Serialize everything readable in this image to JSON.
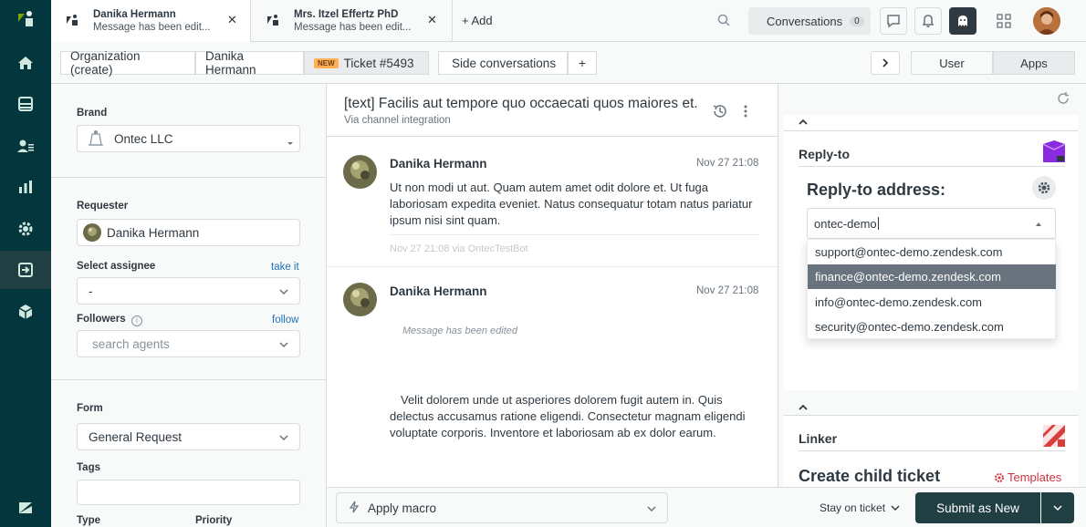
{
  "tabs": [
    {
      "title": "Danika Hermann",
      "subtitle": "Message has been edit..."
    },
    {
      "title": "Mrs. Itzel Effertz PhD",
      "subtitle": "Message has been edit..."
    }
  ],
  "add_tab_label": "+ Add",
  "conversations": {
    "label": "Conversations",
    "count": "0"
  },
  "breadcrumbs": {
    "organization": "Organization (create)",
    "requester": "Danika Hermann",
    "new_badge": "NEW",
    "ticket": "Ticket #5493",
    "side_conversations": "Side conversations",
    "add": "+"
  },
  "right_tabs": {
    "user": "User",
    "apps": "Apps"
  },
  "ticket_fields": {
    "brand_label": "Brand",
    "brand_value": "Ontec LLC",
    "requester_label": "Requester",
    "requester_value": "Danika Hermann",
    "assignee_label": "Select assignee",
    "assignee_link": "take it",
    "assignee_value": "-",
    "followers_label": "Followers",
    "followers_link": "follow",
    "followers_placeholder": "search agents",
    "form_label": "Form",
    "form_value": "General Request",
    "tags_label": "Tags",
    "type_label": "Type",
    "priority_label": "Priority"
  },
  "conversation": {
    "subject": "[text] Facilis aut tempore quo occaecati quos maiores et.",
    "via": "Via channel integration",
    "messages": [
      {
        "author": "Danika Hermann",
        "time": "Nov 27 21:08",
        "body": "Ut non modi ut aut. Quam autem amet odit dolore et. Ut fuga laboriosam expedita eveniet. Natus consequatur totam natus pariatur ipsum nisi sint quam.",
        "meta": "Nov 27 21:08 via OntecTestBot"
      },
      {
        "author": "Danika Hermann",
        "time": "Nov 27 21:08",
        "edited": "Message has been edited",
        "body": "Velit dolorem unde ut asperiores dolorem fugit autem in. Quis delectus accusamus ratione eligendi. Consectetur magnam eligendi voluptate corporis. Inventore et laboriosam ab ex dolor earum."
      }
    ]
  },
  "bottom": {
    "macro": "Apply macro",
    "stay": "Stay on ticket",
    "submit": "Submit as New"
  },
  "reply_to_app": {
    "header": "Reply-to",
    "title": "Reply-to address:",
    "input_value": "ontec-demo",
    "options": [
      "support@ontec-demo.zendesk.com",
      "finance@ontec-demo.zendesk.com",
      "info@ontec-demo.zendesk.com",
      "security@ontec-demo.zendesk.com"
    ],
    "highlighted_index": 1
  },
  "linker_app": {
    "header": "Linker",
    "title": "Create child ticket",
    "templates": "Templates"
  },
  "colors": {
    "nav_bg": "#03363d",
    "accent_dark": "#1f3f43",
    "highlight": "#68737d",
    "link": "#1f73b7",
    "templates": "#cc3340"
  }
}
